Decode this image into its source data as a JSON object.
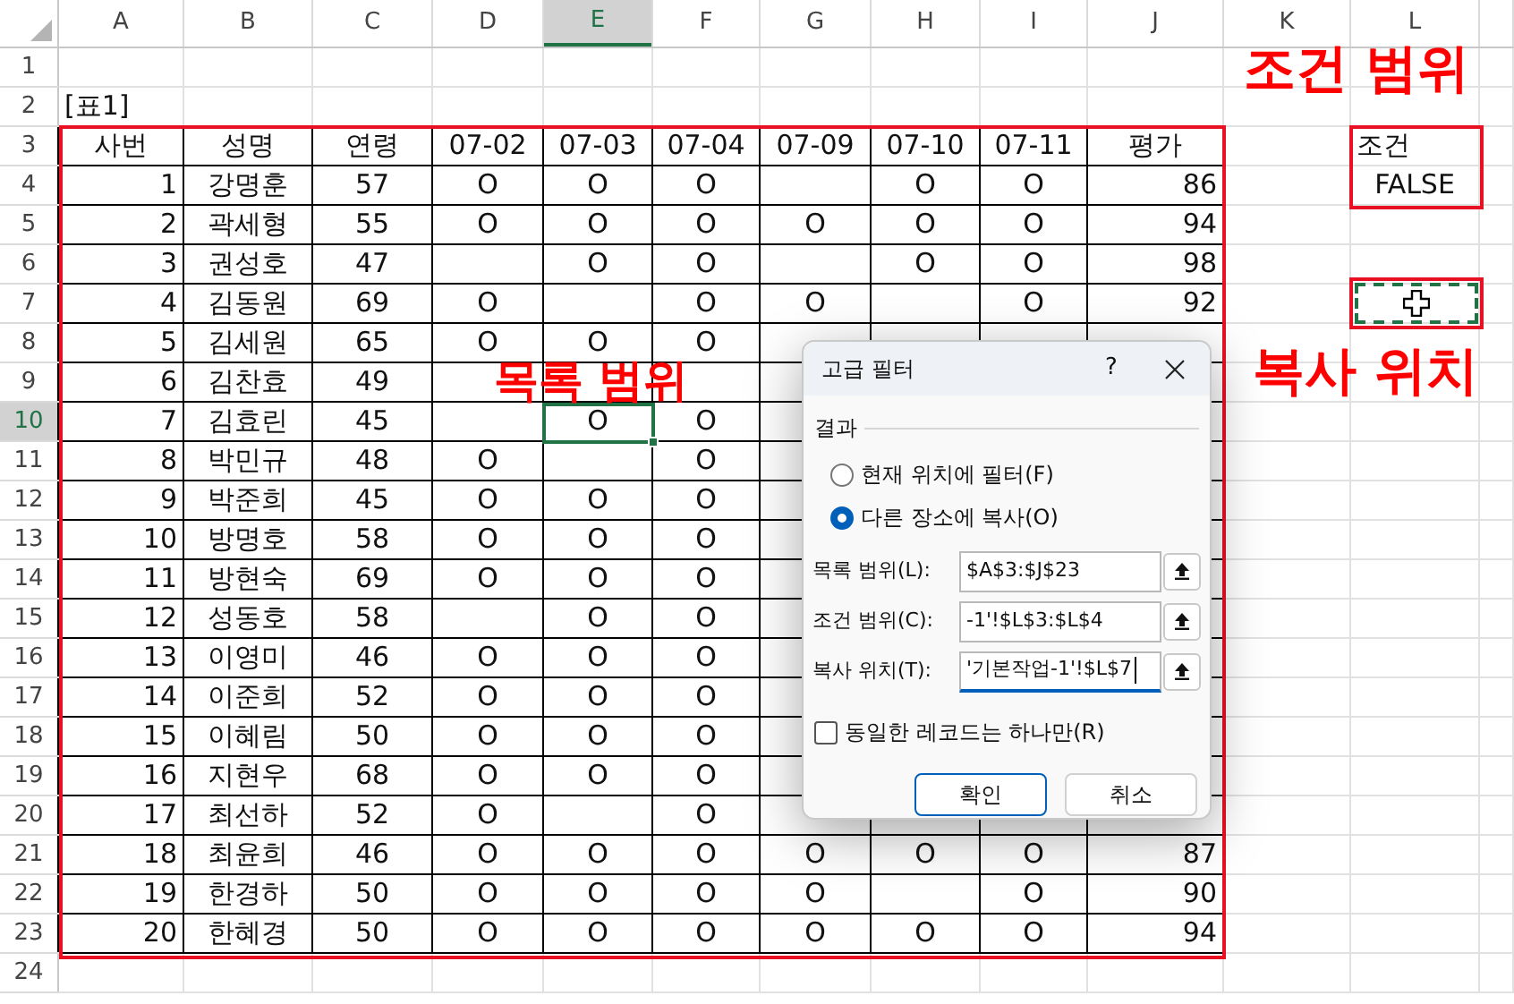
{
  "column_headers": [
    {
      "label": "A",
      "selected": false
    },
    {
      "label": "B",
      "selected": false
    },
    {
      "label": "C",
      "selected": false
    },
    {
      "label": "D",
      "selected": false
    },
    {
      "label": "E",
      "selected": true
    },
    {
      "label": "F",
      "selected": false
    },
    {
      "label": "G",
      "selected": false
    },
    {
      "label": "H",
      "selected": false
    },
    {
      "label": "I",
      "selected": false
    },
    {
      "label": "J",
      "selected": false
    },
    {
      "label": "K",
      "selected": false
    },
    {
      "label": "L",
      "selected": false
    }
  ],
  "row_headers": [
    {
      "label": "1",
      "selected": false
    },
    {
      "label": "2",
      "selected": false
    },
    {
      "label": "3",
      "selected": false
    },
    {
      "label": "4",
      "selected": false
    },
    {
      "label": "5",
      "selected": false
    },
    {
      "label": "6",
      "selected": false
    },
    {
      "label": "7",
      "selected": false
    },
    {
      "label": "8",
      "selected": false
    },
    {
      "label": "9",
      "selected": false
    },
    {
      "label": "10",
      "selected": true
    },
    {
      "label": "11",
      "selected": false
    },
    {
      "label": "12",
      "selected": false
    },
    {
      "label": "13",
      "selected": false
    },
    {
      "label": "14",
      "selected": false
    },
    {
      "label": "15",
      "selected": false
    },
    {
      "label": "16",
      "selected": false
    },
    {
      "label": "17",
      "selected": false
    },
    {
      "label": "18",
      "selected": false
    },
    {
      "label": "19",
      "selected": false
    },
    {
      "label": "20",
      "selected": false
    },
    {
      "label": "21",
      "selected": false
    },
    {
      "label": "22",
      "selected": false
    },
    {
      "label": "23",
      "selected": false
    },
    {
      "label": "24",
      "selected": false
    }
  ],
  "table_title": "[표1]",
  "table": {
    "columns": [
      "사번",
      "성명",
      "연령",
      "07-02",
      "07-03",
      "07-04",
      "07-09",
      "07-10",
      "07-11",
      "평가"
    ],
    "rows": [
      [
        "1",
        "강명훈",
        "57",
        "O",
        "O",
        "O",
        null,
        "O",
        "O",
        "86"
      ],
      [
        "2",
        "곽세형",
        "55",
        "O",
        "O",
        "O",
        "O",
        "O",
        "O",
        "94"
      ],
      [
        "3",
        "권성호",
        "47",
        null,
        "O",
        "O",
        null,
        "O",
        "O",
        "98"
      ],
      [
        "4",
        "김동원",
        "69",
        "O",
        null,
        "O",
        "O",
        null,
        "O",
        "92"
      ],
      [
        "5",
        "김세원",
        "65",
        "O",
        "O",
        "O",
        null,
        null,
        null,
        null
      ],
      [
        "6",
        "김찬효",
        "49",
        null,
        null,
        null,
        null,
        null,
        null,
        null
      ],
      [
        "7",
        "김효린",
        "45",
        null,
        "O",
        "O",
        null,
        null,
        null,
        null
      ],
      [
        "8",
        "박민규",
        "48",
        "O",
        null,
        "O",
        null,
        null,
        null,
        null
      ],
      [
        "9",
        "박준희",
        "45",
        "O",
        "O",
        "O",
        null,
        null,
        null,
        null
      ],
      [
        "10",
        "방명호",
        "58",
        "O",
        "O",
        "O",
        null,
        null,
        null,
        null
      ],
      [
        "11",
        "방현숙",
        "69",
        "O",
        "O",
        "O",
        null,
        null,
        null,
        null
      ],
      [
        "12",
        "성동호",
        "58",
        null,
        "O",
        "O",
        null,
        null,
        null,
        null
      ],
      [
        "13",
        "이영미",
        "46",
        "O",
        "O",
        "O",
        null,
        null,
        null,
        null
      ],
      [
        "14",
        "이준희",
        "52",
        "O",
        "O",
        "O",
        null,
        null,
        null,
        null
      ],
      [
        "15",
        "이혜림",
        "50",
        "O",
        "O",
        "O",
        null,
        null,
        null,
        null
      ],
      [
        "16",
        "지현우",
        "68",
        "O",
        "O",
        "O",
        null,
        null,
        null,
        null
      ],
      [
        "17",
        "최선하",
        "52",
        "O",
        null,
        "O",
        null,
        null,
        null,
        null
      ],
      [
        "18",
        "최윤희",
        "46",
        "O",
        "O",
        "O",
        "O",
        "O",
        "O",
        "87"
      ],
      [
        "19",
        "한경하",
        "50",
        "O",
        "O",
        "O",
        "O",
        null,
        "O",
        "90"
      ],
      [
        "20",
        "한혜경",
        "50",
        "O",
        "O",
        "O",
        "O",
        "O",
        "O",
        "94"
      ]
    ]
  },
  "criteria": {
    "header": "조건",
    "value": "FALSE"
  },
  "annotations": [
    {
      "text": "조건 범위"
    },
    {
      "text": "목록 범위"
    },
    {
      "text": "복사 위치"
    }
  ],
  "dialog": {
    "title": "고급 필터",
    "help": "?",
    "section": "결과",
    "options": [
      {
        "label": "현재 위치에 필터(F)",
        "selected": false
      },
      {
        "label": "다른 장소에 복사(O)",
        "selected": true
      }
    ],
    "fields": [
      {
        "label": "목록 범위(L):",
        "value": "$A$3:$J$23",
        "focused": false
      },
      {
        "label": "조건 범위(C):",
        "value": "-1'!$L$3:$L$4",
        "focused": false
      },
      {
        "label": "복사 위치(T):",
        "value": "'기본작업-1'!$L$7",
        "focused": true
      }
    ],
    "unique_only": {
      "label": "동일한 레코드는 하나만(R)",
      "checked": false
    },
    "buttons": [
      {
        "label": "확인",
        "default": true
      },
      {
        "label": "취소",
        "default": false
      }
    ]
  }
}
